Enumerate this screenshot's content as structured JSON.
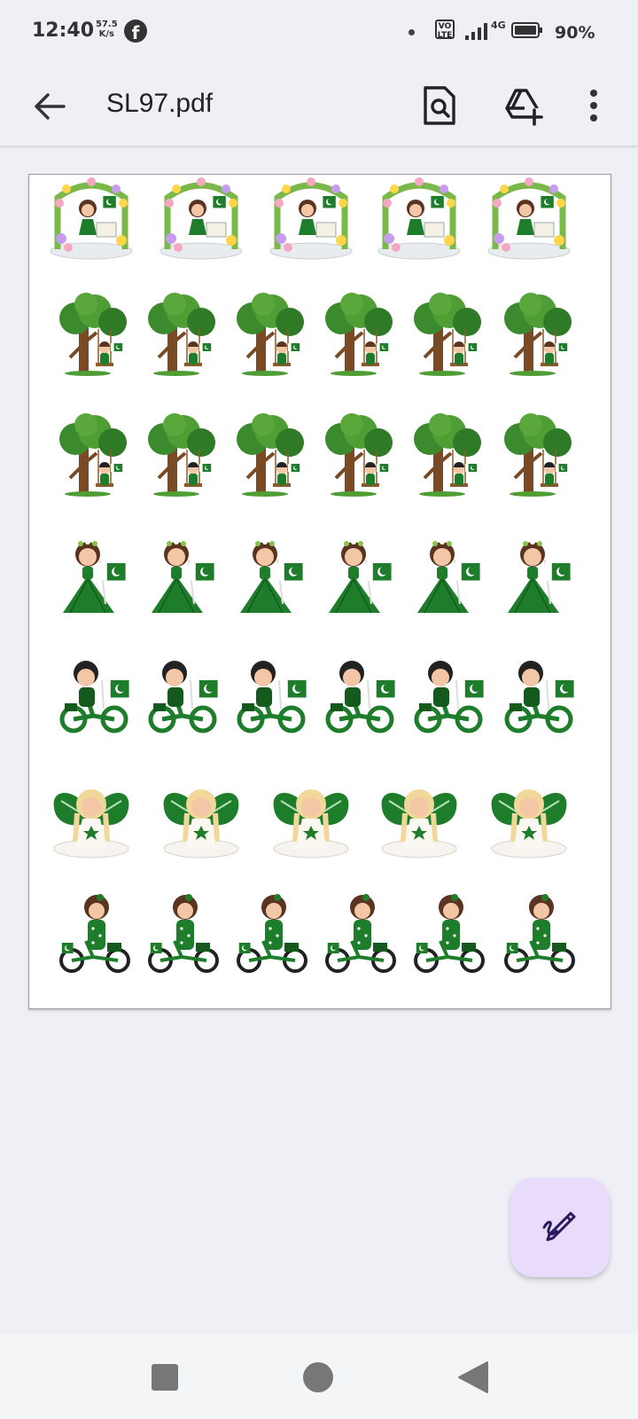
{
  "status_bar": {
    "time": "12:40",
    "net_speed_value": "57.5",
    "net_speed_unit": "K/s",
    "notification_icon": "facebook-icon",
    "volte_label_1": "VO",
    "volte_label_2": "LTE",
    "network_type": "4G",
    "battery_percent": "90%"
  },
  "app_bar": {
    "title": "SL97.pdf",
    "back_icon": "arrow-left-icon",
    "search_icon": "document-search-icon",
    "drive_icon": "add-to-drive-icon",
    "more_icon": "more-vert-icon"
  },
  "pdf_page": {
    "sticker_rows": [
      {
        "motif": "girl-on-swing-floral-arch-sticker",
        "count": 5
      },
      {
        "motif": "tree-swing-girl-sticker",
        "count": 6
      },
      {
        "motif": "tree-swing-boy-sticker",
        "count": 6
      },
      {
        "motif": "girl-green-dress-flag-sticker",
        "count": 6
      },
      {
        "motif": "boy-on-bike-flag-sticker",
        "count": 6
      },
      {
        "motif": "fairy-green-wings-sticker",
        "count": 5
      },
      {
        "motif": "girl-on-bicycle-sticker",
        "count": 6
      }
    ]
  },
  "fab": {
    "icon": "edit-pen-icon"
  },
  "nav_bar": {
    "recents_icon": "square-recents-icon",
    "home_icon": "circle-home-icon",
    "back_icon": "triangle-back-icon"
  },
  "colors": {
    "background": "#eef0f5",
    "fab_background": "#e9dcfb",
    "fab_icon": "#2a1a5e",
    "sticker_green": "#1e7d2a"
  }
}
